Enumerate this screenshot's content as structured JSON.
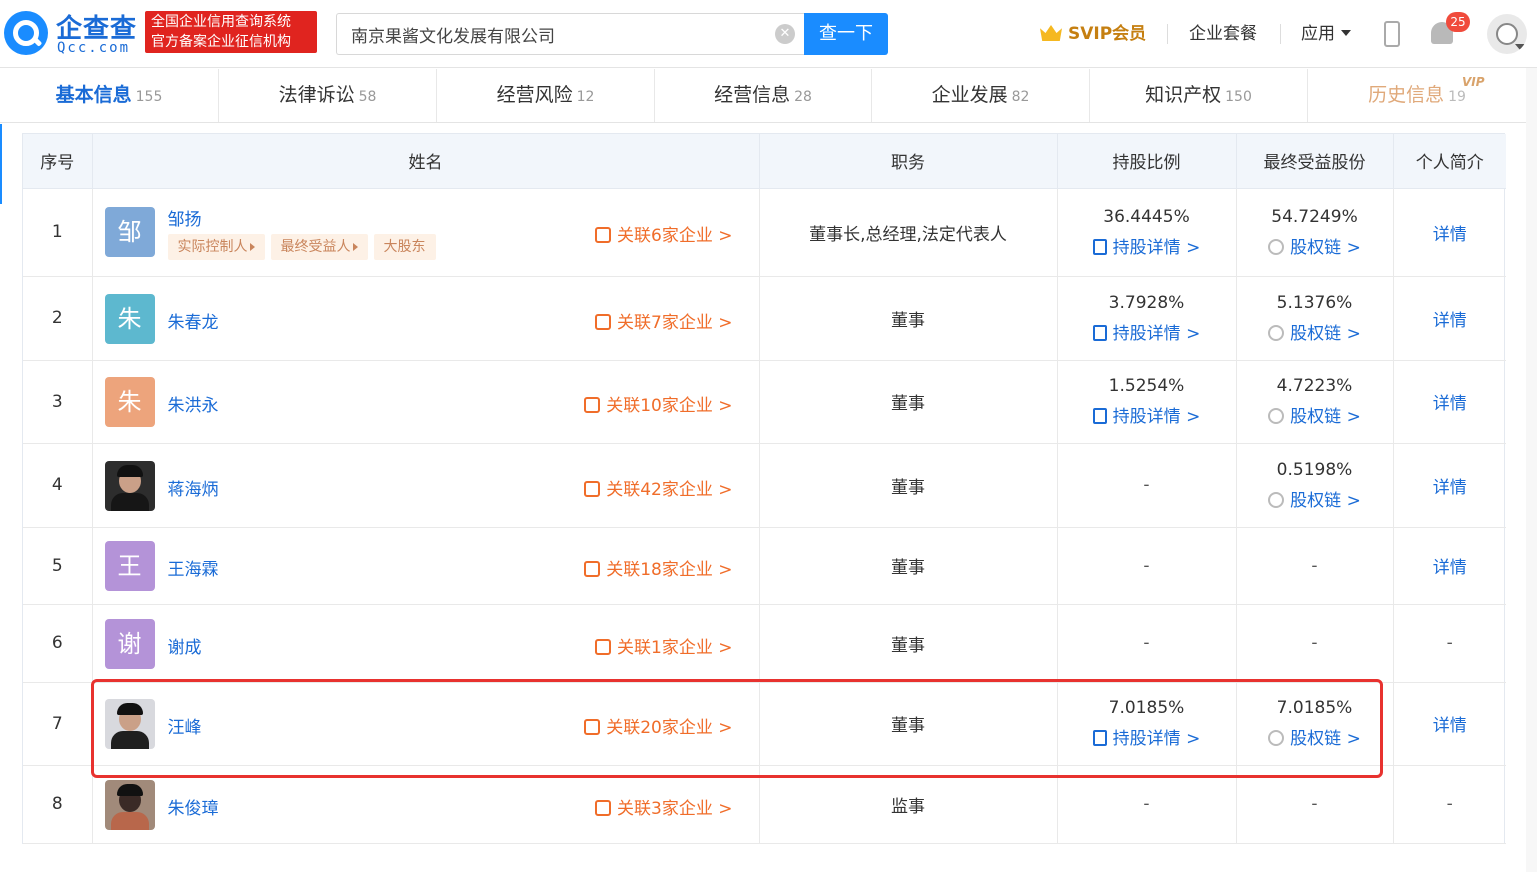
{
  "header": {
    "logo_cn": "企查查",
    "logo_en": "Qcc.com",
    "badge_line1": "全国企业信用查询系统",
    "badge_line2": "官方备案企业征信机构",
    "search_value": "南京果酱文化发展有限公司",
    "search_button": "查一下",
    "svip": "SVIP会员",
    "package": "企业套餐",
    "apps": "应用",
    "notification_count": "25"
  },
  "tabs": [
    {
      "label": "基本信息",
      "count": "155"
    },
    {
      "label": "法律诉讼",
      "count": "58"
    },
    {
      "label": "经营风险",
      "count": "12"
    },
    {
      "label": "经营信息",
      "count": "28"
    },
    {
      "label": "企业发展",
      "count": "82"
    },
    {
      "label": "知识产权",
      "count": "150"
    },
    {
      "label": "历史信息",
      "count": "19"
    }
  ],
  "vip_tag": "VIP",
  "table": {
    "headers": [
      "序号",
      "姓名",
      "职务",
      "持股比例",
      "最终受益股份",
      "个人简介"
    ],
    "hold_detail": "持股详情 >",
    "equity_chain": "股权链 >",
    "detail": "详情",
    "dash": "-",
    "rows": [
      {
        "no": "1",
        "avatar": "邹",
        "name": "邹扬",
        "tags": [
          "实际控制人",
          "最终受益人",
          "大股东"
        ],
        "related": "关联6家企业 >",
        "role": "董事长,总经理,法定代表人",
        "share": "36.4445%",
        "benefit": "54.7249%"
      },
      {
        "no": "2",
        "avatar": "朱",
        "name": "朱春龙",
        "related": "关联7家企业 >",
        "role": "董事",
        "share": "3.7928%",
        "benefit": "5.1376%"
      },
      {
        "no": "3",
        "avatar": "朱",
        "name": "朱洪永",
        "related": "关联10家企业 >",
        "role": "董事",
        "share": "1.5254%",
        "benefit": "4.7223%"
      },
      {
        "no": "4",
        "name": "蒋海炳",
        "related": "关联42家企业 >",
        "role": "董事",
        "share": "-",
        "benefit": "0.5198%"
      },
      {
        "no": "5",
        "avatar": "王",
        "name": "王海霖",
        "related": "关联18家企业 >",
        "role": "董事",
        "share": "-",
        "benefit": "-"
      },
      {
        "no": "6",
        "avatar": "谢",
        "name": "谢成",
        "related": "关联1家企业 >",
        "role": "董事",
        "share": "-",
        "benefit": "-"
      },
      {
        "no": "7",
        "name": "汪峰",
        "related": "关联20家企业 >",
        "role": "董事",
        "share": "7.0185%",
        "benefit": "7.0185%"
      },
      {
        "no": "8",
        "name": "朱俊璋",
        "related": "关联3家企业 >",
        "role": "监事",
        "share": "-",
        "benefit": "-"
      }
    ]
  },
  "colors": {
    "brand": "#1a8cff",
    "link": "#1a6bd6",
    "related": "#f06d2a",
    "highlight": "#e8322f"
  }
}
